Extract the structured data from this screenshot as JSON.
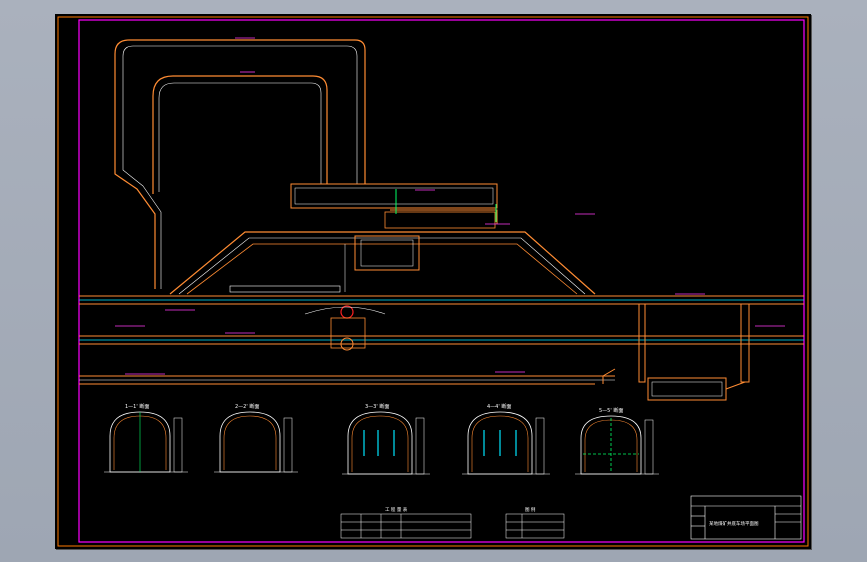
{
  "drawing": {
    "sections": [
      {
        "id": "section-1",
        "label": "1—1' 断面"
      },
      {
        "id": "section-2",
        "label": "2—2' 断面"
      },
      {
        "id": "section-3",
        "label": "3—3' 断面"
      },
      {
        "id": "section-4",
        "label": "4—4' 断面"
      },
      {
        "id": "section-5",
        "label": "5—5' 断面"
      }
    ],
    "title_block": {
      "title": "某地煤矿井底车场平面图"
    },
    "tables": {
      "table_title": "工 程 量 表",
      "legend_title": "图  例"
    }
  },
  "colors": {
    "background": "#000000",
    "frame": "#ff00ff",
    "outer_frame": "#ff7a00",
    "tunnel_wall": "#ff8c33",
    "tunnel_inner": "#ffffff",
    "track": "#00e5ff",
    "dimension": "#ff3df5",
    "accent_green": "#00ff66",
    "accent_red": "#ff2020"
  }
}
